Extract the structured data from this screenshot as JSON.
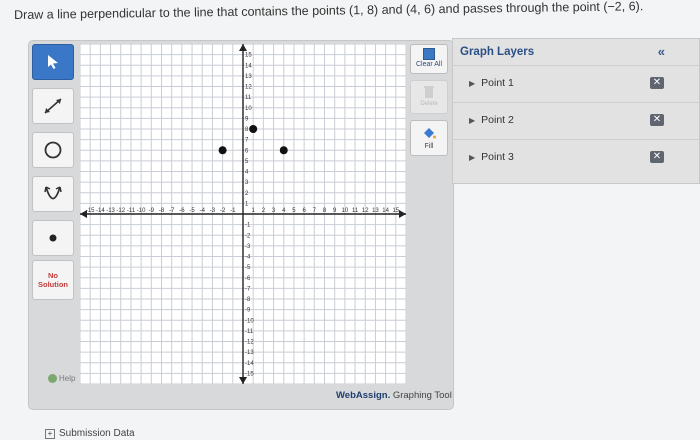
{
  "question": {
    "text": "Draw a line perpendicular to the line that contains the points (1, 8) and (4, 6) and passes through the point (−2, 6)."
  },
  "toolbar": {
    "tools": [
      {
        "name": "pointer",
        "icon": "pointer-arrow-icon",
        "selected": true
      },
      {
        "name": "line",
        "icon": "line-tool-icon"
      },
      {
        "name": "circle",
        "icon": "circle-tool-icon"
      },
      {
        "name": "parabola",
        "icon": "parabola-tool-icon"
      },
      {
        "name": "point",
        "icon": "point-tool-icon"
      }
    ],
    "no_solution_label_1": "No",
    "no_solution_label_2": "Solution",
    "help_label": "Help"
  },
  "graph": {
    "x_range": [
      -16,
      16
    ],
    "y_range": [
      -16,
      16
    ],
    "x_tick_labels": [
      "-15",
      "-14",
      "-13",
      "-12",
      "-11",
      "-10",
      "-9",
      "-8",
      "-7",
      "-6",
      "-5",
      "-4",
      "-3",
      "-2",
      "-1",
      "1",
      "2",
      "3",
      "4",
      "5",
      "6",
      "7",
      "8",
      "9",
      "10",
      "11",
      "12",
      "13",
      "14",
      "15"
    ],
    "y_tick_labels": [
      "15",
      "14",
      "13",
      "12",
      "11",
      "10",
      "9",
      "8",
      "7",
      "6",
      "5",
      "4",
      "3",
      "2",
      "1",
      "-1",
      "-2",
      "-3",
      "-4",
      "-5",
      "-6",
      "-7",
      "-8",
      "-9",
      "-10",
      "-11",
      "-12",
      "-13",
      "-14",
      "-15"
    ],
    "points": [
      {
        "x": -2,
        "y": 6
      },
      {
        "x": 1,
        "y": 8
      },
      {
        "x": 4,
        "y": 6
      }
    ]
  },
  "controls": {
    "clear_all": "Clear All",
    "delete": "Delete",
    "fill": "Fill"
  },
  "brand": {
    "web": "Web",
    "assign": "Assign.",
    "tool": "Graphing Tool"
  },
  "layers": {
    "title": "Graph Layers",
    "collapse": "«",
    "items": [
      {
        "label": "Point 1"
      },
      {
        "label": "Point 2"
      },
      {
        "label": "Point 3"
      }
    ],
    "remove_glyph": "✕"
  },
  "submission": {
    "label": "Submission Data",
    "toggle": "+"
  },
  "colors": {
    "selected_tool": "#3a78c7",
    "layers_title": "#2a4e86",
    "grid_line": "#c9ced6",
    "axis": "#222222"
  }
}
